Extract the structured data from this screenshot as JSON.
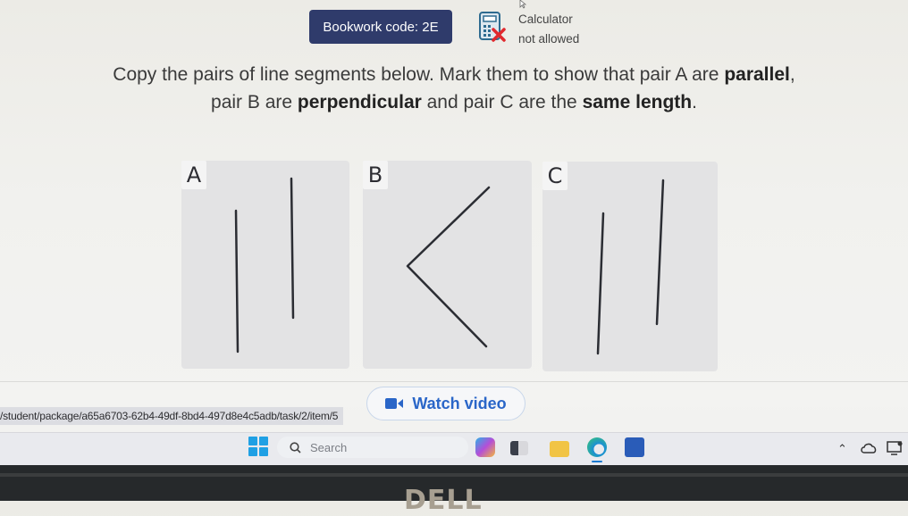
{
  "header": {
    "bookwork_label": "Bookwork code: 2E",
    "calculator_line1": "Calculator",
    "calculator_line2": "not allowed"
  },
  "question": {
    "line1_pre": "Copy the pairs of line segments below. Mark them to show that pair A are ",
    "line1_bold": "parallel",
    "line1_post": ",",
    "line2_pre": "pair B are ",
    "line2_bold1": "perpendicular",
    "line2_mid": " and pair C are the ",
    "line2_bold2": "same length",
    "line2_post": "."
  },
  "panels": [
    {
      "label": "A",
      "description": "two parallel vertical segments of different lengths"
    },
    {
      "label": "B",
      "description": "two perpendicular segments meeting at a vertex on the left"
    },
    {
      "label": "C",
      "description": "two slightly slanted segments of equal length"
    }
  ],
  "watch_video": {
    "label": "Watch video",
    "icon": "video-camera-icon",
    "color": "#2a66c8"
  },
  "status_url": "/student/package/a65a6703-62b4-49df-8bd4-497d8e4c5adb/task/2/item/5",
  "taskbar": {
    "search_placeholder": "Search",
    "apps": [
      "copilot-icon",
      "task-view-icon",
      "file-explorer-icon",
      "edge-icon",
      "store-icon"
    ],
    "tray": [
      "chevron-up-icon",
      "onedrive-icon",
      "display-icon"
    ]
  },
  "bezel_logo": "DELL"
}
